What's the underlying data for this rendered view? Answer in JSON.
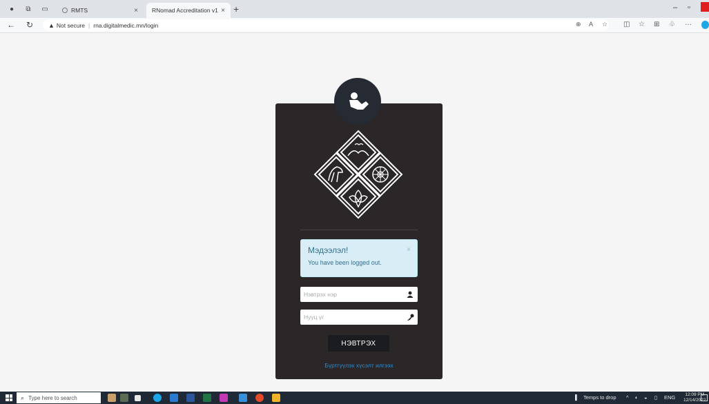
{
  "browser": {
    "tabs": [
      {
        "label": "RMTS",
        "close": "×"
      },
      {
        "label": "RNomad Accreditation v1.0",
        "close": "×"
      }
    ],
    "new_tab": "+",
    "address": {
      "security": "Not secure",
      "url": "rna.digitalmedic.mn/login"
    }
  },
  "login": {
    "alert": {
      "title": "Мэдээлэл!",
      "message": "You have been logged out.",
      "close": "×"
    },
    "username_placeholder": "Нэвтрэх нэр",
    "password_placeholder": "Нууц үг",
    "submit_label": "НЭВТРЭХ",
    "register_link": "Бүртгүүлэх хүсэлт илгээх"
  },
  "taskbar": {
    "search_placeholder": "Type here to search",
    "weather": "Temps to drop",
    "language": "ENG",
    "time": "12:09 PM",
    "date": "12/14/2022"
  },
  "colors": {
    "card_bg": "#2b2627",
    "alert_bg": "#d9edf7",
    "alert_text": "#31708f",
    "link": "#2a8fd6",
    "button_bg": "#1b1c20"
  }
}
